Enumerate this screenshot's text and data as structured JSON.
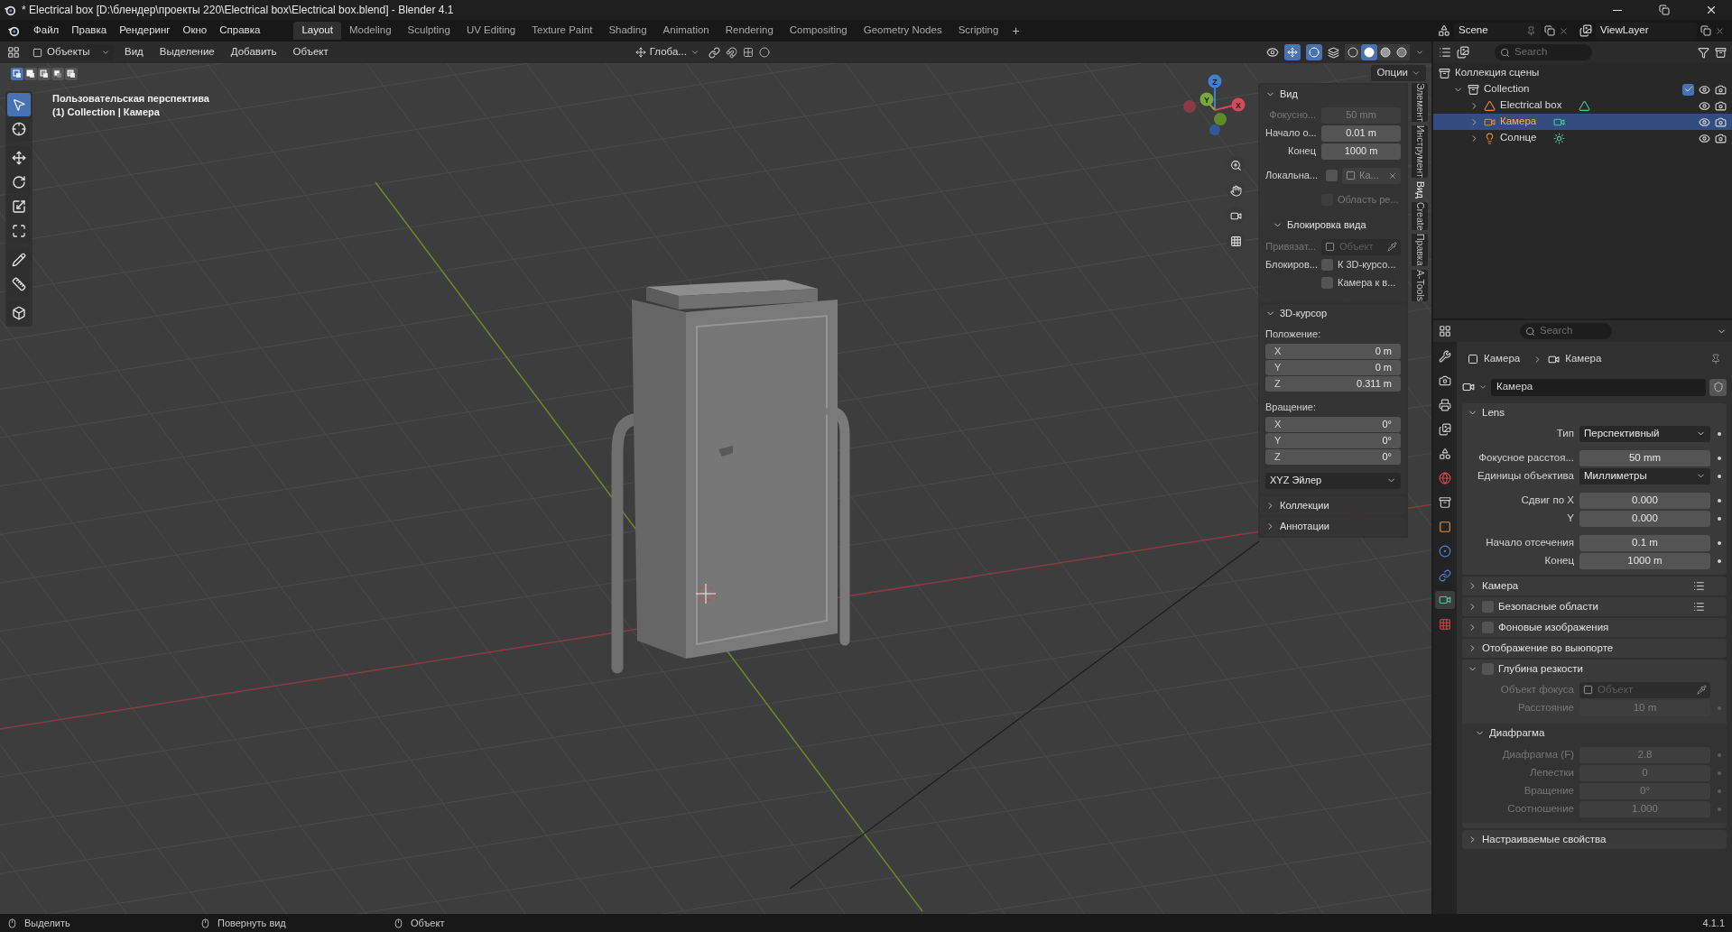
{
  "window": {
    "title": "* Electrical box [D:\\блендер\\проекты 220\\Electrical box\\Electrical box.blend] - Blender 4.1"
  },
  "menu": [
    "Файл",
    "Правка",
    "Рендеринг",
    "Окно",
    "Справка"
  ],
  "workspaces": [
    {
      "label": "Layout",
      "selected": true
    },
    {
      "label": "Modeling",
      "selected": false
    },
    {
      "label": "Sculpting",
      "selected": false
    },
    {
      "label": "UV Editing",
      "selected": false
    },
    {
      "label": "Texture Paint",
      "selected": false
    },
    {
      "label": "Shading",
      "selected": false
    },
    {
      "label": "Animation",
      "selected": false
    },
    {
      "label": "Rendering",
      "selected": false
    },
    {
      "label": "Compositing",
      "selected": false
    },
    {
      "label": "Geometry Nodes",
      "selected": false
    },
    {
      "label": "Scripting",
      "selected": false
    }
  ],
  "add_workspace": "+",
  "scene": "Scene",
  "view_layer": "ViewLayer",
  "viewport": {
    "mode": "Объекты",
    "menus": [
      "Вид",
      "Выделение",
      "Добавить",
      "Объект"
    ],
    "orientation": "Глоба...",
    "options": "Опции",
    "select_modes": [
      {
        "kind": "set",
        "selected": true
      },
      {
        "kind": "extend",
        "selected": false
      },
      {
        "kind": "subtract",
        "selected": false
      },
      {
        "kind": "invert",
        "selected": false
      },
      {
        "kind": "intersect",
        "selected": false
      }
    ],
    "shading": [
      {
        "kind": "wireframe",
        "selected": false
      },
      {
        "kind": "solid",
        "selected": true
      },
      {
        "kind": "material",
        "selected": false
      },
      {
        "kind": "rendered",
        "selected": false
      }
    ],
    "overlay_text": [
      "Пользовательская перспектива",
      "(1) Collection | Камера"
    ],
    "gizmo": [
      "Z",
      "Y",
      "X"
    ],
    "tools": [
      [
        {
          "kind": "select",
          "selected": true
        },
        {
          "kind": "cursor",
          "selected": false
        }
      ],
      [
        {
          "kind": "move",
          "selected": false
        },
        {
          "kind": "rotate",
          "selected": false
        },
        {
          "kind": "scale",
          "selected": false
        },
        {
          "kind": "transform",
          "selected": false
        }
      ],
      [
        {
          "kind": "annotate",
          "selected": false
        },
        {
          "kind": "measure",
          "selected": false
        }
      ],
      [
        {
          "kind": "add_cube",
          "selected": false
        }
      ]
    ]
  },
  "sidebar": {
    "tabs": [
      {
        "label": "Элемент",
        "selected": false
      },
      {
        "label": "Инструмент",
        "selected": false
      },
      {
        "label": "Вид",
        "selected": true
      },
      {
        "label": "Create",
        "selected": false
      },
      {
        "label": "Правка",
        "selected": false
      },
      {
        "label": "A-Tools",
        "selected": false
      }
    ],
    "panels": [
      {
        "label": "Вид",
        "expanded": true,
        "groups": [
          [
            {
              "kind": "field",
              "label": "Фокусно...",
              "value": "50 mm",
              "disabled": true
            },
            {
              "kind": "field",
              "label": "Начало о...",
              "value": "0.01 m",
              "disabled": false
            },
            {
              "kind": "field",
              "label": "Конец",
              "value": "1000 m",
              "disabled": false
            }
          ],
          [
            {
              "kind": "local",
              "label": "Локальна...",
              "checked": false,
              "value": "Ка..."
            }
          ],
          [
            {
              "kind": "checkbox",
              "text": "Область ре...",
              "checked": false,
              "disabled": true
            }
          ],
          [
            {
              "kind": "subpanel",
              "label": "Блокировка вида",
              "expanded": true,
              "groups": [
                [
                  {
                    "kind": "object",
                    "label": "Привязат...",
                    "placeholder": "Объект",
                    "disabled": true
                  },
                  {
                    "kind": "checkbox",
                    "label": "Блокиров...",
                    "text": "К 3D-курсо...",
                    "checked": false,
                    "disabled": false
                  },
                  {
                    "kind": "checkbox",
                    "text": "Камера к в...",
                    "checked": false,
                    "disabled": false
                  }
                ]
              ]
            }
          ]
        ]
      },
      {
        "label": "3D-курсор",
        "expanded": true,
        "groups": [
          [
            {
              "kind": "caption",
              "label": "Положение:"
            },
            {
              "kind": "vector",
              "items": [
                {
                  "axis": "X",
                  "value": "0 m"
                },
                {
                  "axis": "Y",
                  "value": "0 m"
                },
                {
                  "axis": "Z",
                  "value": "0.311 m"
                }
              ]
            }
          ],
          [
            {
              "kind": "caption",
              "label": "Вращение:"
            },
            {
              "kind": "vector",
              "items": [
                {
                  "axis": "X",
                  "value": "0°"
                },
                {
                  "axis": "Y",
                  "value": "0°"
                },
                {
                  "axis": "Z",
                  "value": "0°"
                }
              ]
            }
          ],
          [
            {
              "kind": "dropdown",
              "value": "XYZ Эйлер"
            }
          ]
        ]
      },
      {
        "label": "Коллекции",
        "expanded": false
      },
      {
        "label": "Аннотации",
        "expanded": false
      }
    ]
  },
  "outliner": {
    "search_placeholder": "Search",
    "root": {
      "label": "Коллекция сцены",
      "kind": "scene_collection",
      "children": [
        {
          "label": "Collection",
          "kind": "collection",
          "expanded": true,
          "checked": true,
          "children": [
            {
              "label": "Electrical box",
              "kind": "mesh",
              "expanded": false,
              "selected": false
            },
            {
              "label": "Камера",
              "kind": "camera",
              "expanded": false,
              "selected": true
            },
            {
              "label": "Солнце",
              "kind": "light",
              "expanded": false,
              "selected": false
            }
          ]
        }
      ]
    }
  },
  "properties": {
    "search_placeholder": "Search",
    "tabs": [
      {
        "kind": "tool",
        "selected": false
      },
      {
        "kind": "render",
        "selected": false
      },
      {
        "kind": "output",
        "selected": false
      },
      {
        "kind": "view_layer",
        "selected": false
      },
      {
        "kind": "scene",
        "selected": false
      },
      {
        "kind": "world",
        "selected": false
      },
      {
        "kind": "collection",
        "selected": false
      },
      {
        "kind": "object",
        "selected": false
      },
      {
        "kind": "physics",
        "selected": false
      },
      {
        "kind": "constraints",
        "selected": false
      },
      {
        "kind": "data",
        "selected": true
      },
      {
        "kind": "texture",
        "selected": false
      }
    ],
    "breadcrumb": [
      "Камера",
      "Камера"
    ],
    "datablock": "Камера",
    "panels": [
      {
        "label": "Lens",
        "expanded": true,
        "groups": [
          [
            {
              "kind": "dropdown",
              "label": "Тип",
              "value": "Перспективный"
            }
          ],
          [
            {
              "kind": "field",
              "label": "Фокусное расстоя...",
              "value": "50 mm",
              "disabled": false
            },
            {
              "kind": "dropdown",
              "label": "Единицы объектива",
              "value": "Миллиметры"
            }
          ],
          [
            {
              "kind": "field",
              "label": "Сдвиг по X",
              "value": "0.000",
              "disabled": false
            },
            {
              "kind": "field",
              "label": "Y",
              "value": "0.000",
              "disabled": false
            }
          ],
          [
            {
              "kind": "field",
              "label": "Начало отсечения",
              "value": "0.1 m",
              "disabled": false
            },
            {
              "kind": "field",
              "label": "Конец",
              "value": "1000 m",
              "disabled": false
            }
          ]
        ]
      },
      {
        "label": "Камера",
        "expanded": false,
        "presets": true
      },
      {
        "label": "Безопасные области",
        "expanded": false,
        "checked": false,
        "presets": true
      },
      {
        "label": "Фоновые изображения",
        "expanded": false,
        "checked": false
      },
      {
        "label": "Отображение во выюпорте",
        "expanded": false
      },
      {
        "label": "Глубина резкости",
        "expanded": true,
        "checked": false,
        "groups": [
          [
            {
              "kind": "object",
              "label": "Объект фокуса",
              "placeholder": "Объект",
              "disabled": true
            },
            {
              "kind": "field",
              "label": "Расстояние",
              "value": "10 m",
              "disabled": true
            }
          ],
          [
            {
              "kind": "subpanel",
              "label": "Диафрагма",
              "expanded": true,
              "groups": [
                [
                  {
                    "kind": "field",
                    "label": "Диафрагма (F)",
                    "value": "2.8",
                    "disabled": true
                  },
                  {
                    "kind": "field",
                    "label": "Лепестки",
                    "value": "0",
                    "disabled": true
                  },
                  {
                    "kind": "field",
                    "label": "Вращение",
                    "value": "0°",
                    "disabled": true
                  },
                  {
                    "kind": "field",
                    "label": "Соотношение",
                    "value": "1.000",
                    "disabled": true
                  }
                ]
              ]
            }
          ]
        ]
      },
      {
        "label": "Настраиваемые свойства",
        "expanded": false
      }
    ]
  },
  "status_bar": {
    "hints": [
      "Выделить",
      "Повернуть вид",
      "Объект"
    ],
    "version": "4.1.1"
  }
}
